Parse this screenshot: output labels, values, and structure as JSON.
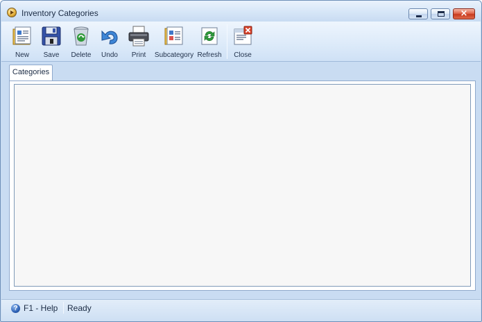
{
  "window": {
    "title": "Inventory Categories",
    "icons": {
      "app": "app-icon",
      "minimize": "minimize-icon",
      "maximize": "maximize-icon",
      "close": "close-icon",
      "close_glyph": "×"
    }
  },
  "toolbar": {
    "items": [
      {
        "label": "New",
        "icon": "new-document-icon"
      },
      {
        "label": "Save",
        "icon": "floppy-disk-icon"
      },
      {
        "label": "Delete",
        "icon": "recycle-bin-icon"
      },
      {
        "label": "Undo",
        "icon": "undo-arrow-icon"
      },
      {
        "label": "Print",
        "icon": "printer-icon"
      },
      {
        "label": "Subcategory",
        "icon": "subcategory-icon"
      },
      {
        "label": "Refresh",
        "icon": "refresh-icon"
      },
      {
        "label": "Close",
        "icon": "close-form-icon"
      }
    ]
  },
  "tabs": [
    {
      "label": "Categories",
      "active": true
    }
  ],
  "statusbar": {
    "help": "F1 - Help",
    "help_icon_glyph": "?",
    "status": "Ready"
  },
  "colors": {
    "frame": "#c9dcf2",
    "toolbar": "#dceaf9",
    "panel_border": "#8fa9cc",
    "close_button": "#c73a1f"
  }
}
